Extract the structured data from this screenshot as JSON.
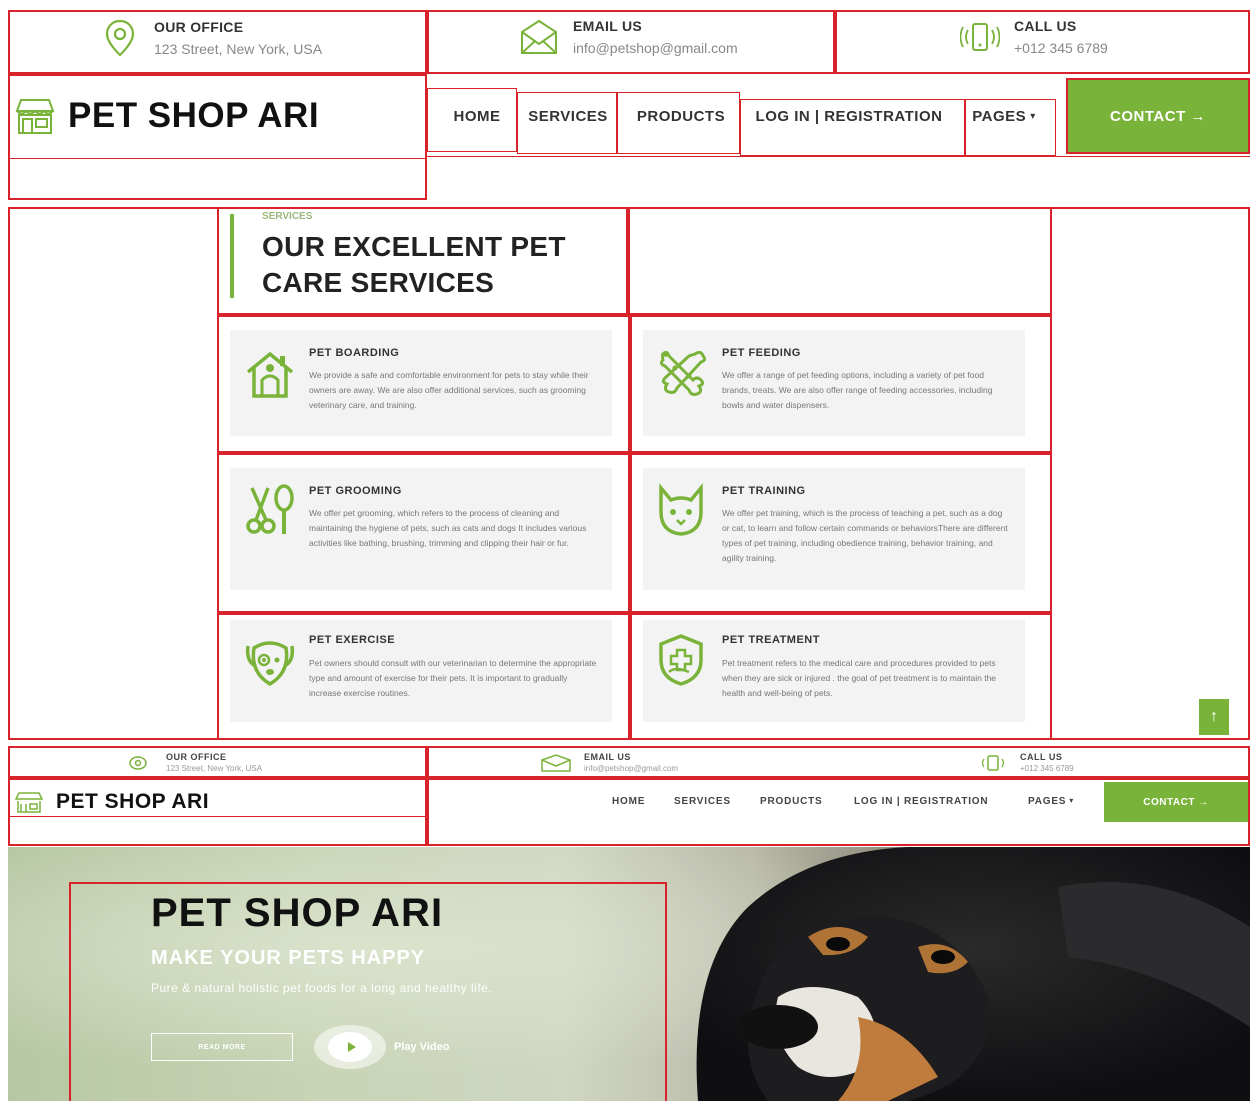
{
  "topbar": {
    "office": {
      "title": "OUR OFFICE",
      "value": "123 Street, New York, USA"
    },
    "email": {
      "title": "EMAIL US",
      "value": "info@petshop@gmail.com"
    },
    "call": {
      "title": "CALL US",
      "value": "+012 345 6789"
    }
  },
  "brand": {
    "name": "PET SHOP ARI"
  },
  "nav": {
    "items": [
      "HOME",
      "SERVICES",
      "PRODUCTS",
      "LOG IN | REGISTRATION",
      "PAGES"
    ],
    "pages_caret": "▾",
    "contact": "CONTACT →"
  },
  "services": {
    "kicker": "SERVICES",
    "heading_line1": "OUR EXCELLENT PET",
    "heading_line2": "CARE SERVICES",
    "cards": [
      {
        "title": "PET BOARDING",
        "icon": "house-icon",
        "text": "We provide a safe and comfortable environment for pets to stay while their owners are away. We are also offer additional services, such as grooming veterinary care, and training."
      },
      {
        "title": "PET FEEDING",
        "icon": "bone-food-icon",
        "text": "We offer a range of pet feeding options, including a variety of pet food brands, treats. We are also offer range of feeding accessories, including bowls and water dispensers."
      },
      {
        "title": "PET GROOMING",
        "icon": "grooming-icon",
        "text": "We offer pet grooming, which refers to the process of cleaning and maintaining the hygiene of pets, such as cats and dogs It includes various activities like bathing, brushing, trimming and clipping their hair or fur."
      },
      {
        "title": "PET TRAINING",
        "icon": "cat-icon",
        "text": "We offer pet training, which is the process of teaching a pet, such as a dog or cat, to learn and follow certain commands or behaviorsThere are different types of pet training, including obedience training, behavior training, and agility training."
      },
      {
        "title": "PET EXERCISE",
        "icon": "dog-icon",
        "text": "Pet owners should consult with our veterinarian to determine the appropriate type and amount of exercise for their pets. It is important to gradually increase exercise routines."
      },
      {
        "title": "PET TREATMENT",
        "icon": "shield-icon",
        "text": "Pet treatment refers to the medical care and procedures provided to pets when they are sick or injured . the goal of pet treatment is to maintain the health and well-being of pets."
      }
    ]
  },
  "back_to_top": "↑",
  "hero": {
    "title": "PET SHOP ARI",
    "subtitle": "MAKE YOUR PETS HAPPY",
    "tagline": "Pure & natural holistic pet foods for a long and healthy life.",
    "read_more": "READ MORE",
    "play_video": "Play Video"
  },
  "colors": {
    "accent": "#7ab33a",
    "annotation": "#d8232a"
  }
}
